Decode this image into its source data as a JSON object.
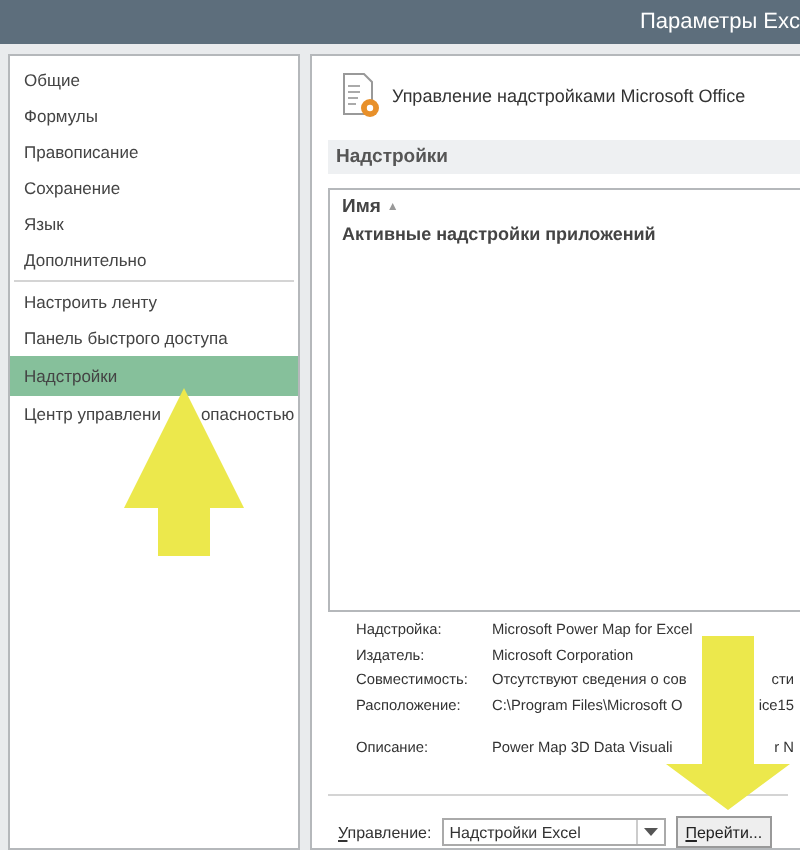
{
  "window": {
    "title": "Параметры Exc"
  },
  "sidebar": {
    "groups": [
      {
        "items": [
          {
            "label": "Общие",
            "selected": false
          },
          {
            "label": "Формулы",
            "selected": false
          },
          {
            "label": "Правописание",
            "selected": false
          },
          {
            "label": "Сохранение",
            "selected": false
          },
          {
            "label": "Язык",
            "selected": false
          },
          {
            "label": "Дополнительно",
            "selected": false
          }
        ]
      },
      {
        "items": [
          {
            "label": "Настроить ленту",
            "selected": false
          },
          {
            "label": "Панель быстрого доступа",
            "selected": false
          },
          {
            "label": "Надстройки",
            "selected": true
          },
          {
            "label": "Центр управлени",
            "label_end": "опасностью",
            "selected": false
          }
        ]
      }
    ]
  },
  "main": {
    "heading": "Управление надстройками Microsoft Office",
    "section": "Надстройки",
    "table": {
      "column": "Имя",
      "sort_glyph": "▲",
      "group": "Активные надстройки приложений"
    },
    "details": [
      {
        "label": "Надстройка:",
        "value": "Microsoft Power Map for Excel"
      },
      {
        "label": "Издатель:",
        "value": "Microsoft Corporation"
      },
      {
        "label": "Совместимость:",
        "value": "Отсутствуют сведения о сов",
        "value_end": "сти"
      },
      {
        "label": "Расположение:",
        "value": "C:\\Program Files\\Microsoft O",
        "value_end": "ice15"
      },
      {
        "label": "Описание:",
        "value": "Power Map 3D Data Visuali",
        "value_end": "r N",
        "spaced": true
      }
    ],
    "manage": {
      "label_key": "У",
      "label": "правление:",
      "value": "Надстройки Excel",
      "go_key": "П",
      "go": "ерейти..."
    }
  },
  "annotations": [
    {
      "kind": "arrow-up"
    },
    {
      "kind": "arrow-down"
    }
  ]
}
